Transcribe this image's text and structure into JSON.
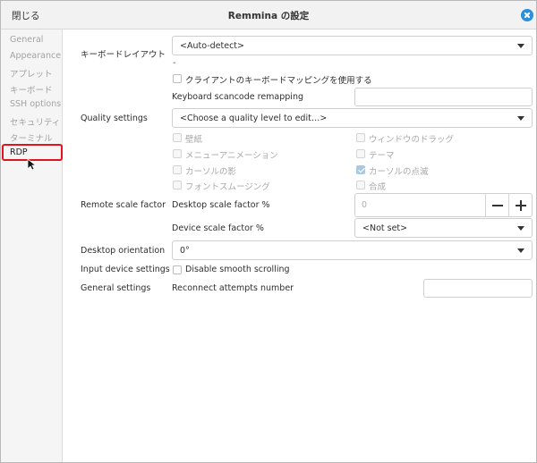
{
  "titlebar": {
    "close_label": "閉じる",
    "title": "Remmina の設定"
  },
  "sidebar": {
    "items": [
      {
        "label": "General"
      },
      {
        "label": "Appearance"
      },
      {
        "label": "アプレット"
      },
      {
        "label": "キーボード"
      },
      {
        "label": "SSH options"
      },
      {
        "label": "セキュリティ"
      },
      {
        "label": "ターミナル"
      },
      {
        "label": "RDP"
      }
    ],
    "active": "RDP"
  },
  "rdp": {
    "keyboard_layout_label": "キーボードレイアウト",
    "keyboard_layout_value": "<Auto-detect>",
    "keyboard_layout_dash": "-",
    "client_keyboard_mapping_label": "クライアントのキーボードマッピングを使用する",
    "scancode_remapping_label": "Keyboard scancode remapping",
    "scancode_remapping_value": "",
    "quality_settings_label": "Quality settings",
    "quality_settings_value": "<Choose a quality level to edit…>",
    "quality_options": {
      "wallpaper": "壁紙",
      "window_drag": "ウィンドウのドラッグ",
      "menu_animation": "メニューアニメーション",
      "theme": "テーマ",
      "cursor_shadow": "カーソルの影",
      "cursor_blink": "カーソルの点滅",
      "font_smoothing": "フォントスムージング",
      "composition": "合成"
    },
    "remote_scale_label": "Remote scale factor",
    "desktop_scale_label": "Desktop scale factor %",
    "desktop_scale_value": "0",
    "device_scale_label": "Device scale factor %",
    "device_scale_value": "<Not set>",
    "desktop_orientation_label": "Desktop orientation",
    "desktop_orientation_value": "0°",
    "input_device_label": "Input device settings",
    "disable_smooth_scrolling_label": "Disable smooth scrolling",
    "general_settings_label": "General settings",
    "reconnect_attempts_label": "Reconnect attempts number",
    "reconnect_attempts_value": ""
  },
  "colors": {
    "accent": "#2a8fdc",
    "highlight": "#e0141c"
  }
}
